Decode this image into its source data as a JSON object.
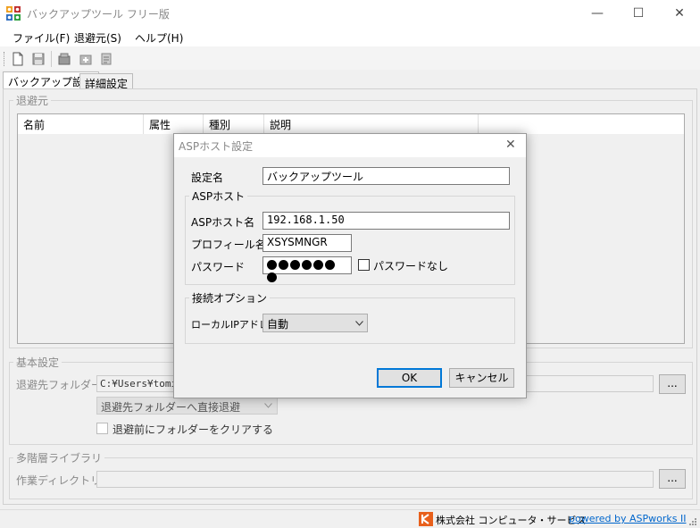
{
  "window": {
    "title": "バックアップツール フリー版",
    "minimize": "—",
    "maximize": "☐",
    "close": "✕"
  },
  "menu": [
    "ファイル(F)",
    "退避元(S)",
    "ヘルプ(H)"
  ],
  "tabs": [
    "バックアップ設定",
    "詳細設定"
  ],
  "source_group": {
    "legend": "退避元",
    "columns": [
      "名前",
      "属性",
      "種別",
      "説明"
    ]
  },
  "basic": {
    "legend": "基本設定",
    "dest_label": "退避先フォルダー",
    "dest_value": "C:¥Users¥tomi¥",
    "browse": "...",
    "mode_value": "退避先フォルダーへ直接退避",
    "clear_label": "退避前にフォルダーをクリアする"
  },
  "library": {
    "legend": "多階層ライブラリ",
    "workdir_label": "作業ディレクトリ",
    "browse": "..."
  },
  "status": {
    "company": "株式会社 コンピュータ・サービス",
    "powered": "powered by ASPworks II"
  },
  "dialog": {
    "title": "ASPホスト設定",
    "close": "✕",
    "name_label": "設定名",
    "name_value": "バックアップツール",
    "host_group": "ASPホスト",
    "host_label": "ASPホスト名",
    "host_value": "192.168.1.50",
    "profile_label": "プロフィール名",
    "profile_value": "XSYSMNGR",
    "password_label": "パスワード",
    "nopass_label": "パスワードなし",
    "conn_group": "接続オプション",
    "localip_label": "ローカルIPアドレス",
    "localip_value": "自動",
    "ok": "OK",
    "cancel": "キャンセル"
  },
  "colors": {
    "link": "#0066cc",
    "accent": "#0078d7",
    "logo": "#e8601c"
  }
}
